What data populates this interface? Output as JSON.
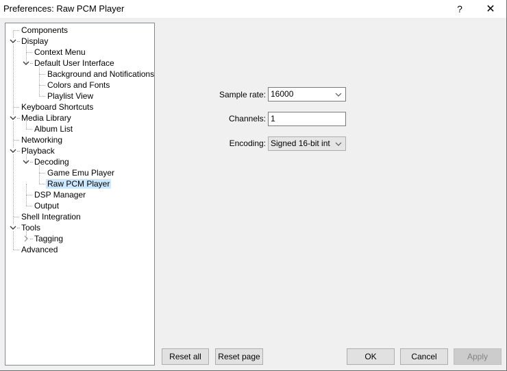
{
  "window": {
    "title": "Preferences: Raw PCM Player",
    "help_glyph": "?",
    "close_glyph": "✕"
  },
  "tree": {
    "items": [
      {
        "label": "Components",
        "level": 0,
        "expander": "none"
      },
      {
        "label": "Display",
        "level": 0,
        "expander": "expanded"
      },
      {
        "label": "Context Menu",
        "level": 1,
        "expander": "none"
      },
      {
        "label": "Default User Interface",
        "level": 1,
        "expander": "expanded"
      },
      {
        "label": "Background and Notifications",
        "level": 2,
        "expander": "none"
      },
      {
        "label": "Colors and Fonts",
        "level": 2,
        "expander": "none"
      },
      {
        "label": "Playlist View",
        "level": 2,
        "expander": "none"
      },
      {
        "label": "Keyboard Shortcuts",
        "level": 0,
        "expander": "none"
      },
      {
        "label": "Media Library",
        "level": 0,
        "expander": "expanded"
      },
      {
        "label": "Album List",
        "level": 1,
        "expander": "none"
      },
      {
        "label": "Networking",
        "level": 0,
        "expander": "none"
      },
      {
        "label": "Playback",
        "level": 0,
        "expander": "expanded"
      },
      {
        "label": "Decoding",
        "level": 1,
        "expander": "expanded"
      },
      {
        "label": "Game Emu Player",
        "level": 2,
        "expander": "none"
      },
      {
        "label": "Raw PCM Player",
        "level": 2,
        "expander": "none",
        "selected": true
      },
      {
        "label": "DSP Manager",
        "level": 1,
        "expander": "none"
      },
      {
        "label": "Output",
        "level": 1,
        "expander": "none"
      },
      {
        "label": "Shell Integration",
        "level": 0,
        "expander": "none"
      },
      {
        "label": "Tools",
        "level": 0,
        "expander": "expanded"
      },
      {
        "label": "Tagging",
        "level": 1,
        "expander": "collapsed"
      },
      {
        "label": "Advanced",
        "level": 0,
        "expander": "none"
      }
    ]
  },
  "settings": {
    "sample_rate": {
      "label": "Sample rate:",
      "value": "16000"
    },
    "channels": {
      "label": "Channels:",
      "value": "1"
    },
    "encoding": {
      "label": "Encoding:",
      "value": "Signed 16-bit int"
    }
  },
  "buttons": {
    "reset_all": "Reset all",
    "reset_page": "Reset page",
    "ok": "OK",
    "cancel": "Cancel",
    "apply": "Apply"
  },
  "icons": {
    "expanded": "⌄",
    "collapsed": "›",
    "dropdown": "⌄"
  }
}
